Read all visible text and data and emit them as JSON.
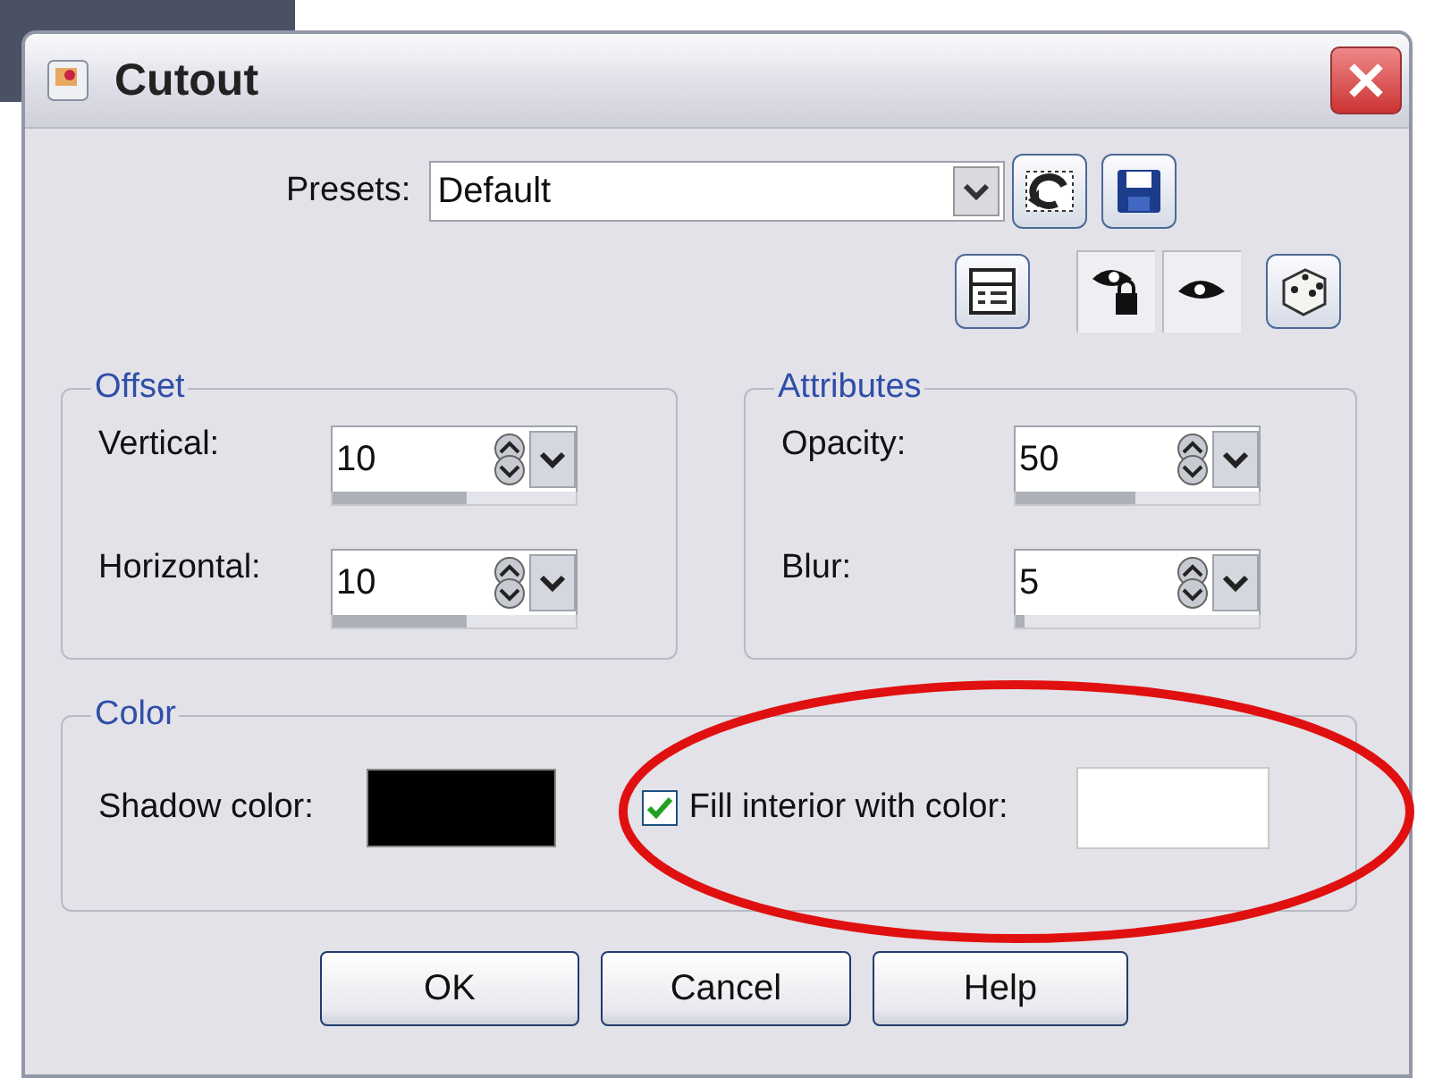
{
  "window": {
    "title": "Cutout"
  },
  "presets": {
    "label": "Presets:",
    "value": "Default"
  },
  "offset": {
    "title": "Offset",
    "fields": [
      {
        "label": "Vertical:",
        "value": "10",
        "level": 0.55
      },
      {
        "label": "Horizontal:",
        "value": "10",
        "level": 0.55
      }
    ]
  },
  "attributes": {
    "title": "Attributes",
    "fields": [
      {
        "label": "Opacity:",
        "value": "50",
        "level": 0.49
      },
      {
        "label": "Blur:",
        "value": "5",
        "level": 0.04
      }
    ]
  },
  "color": {
    "title": "Color",
    "shadow": {
      "label": "Shadow color:",
      "color": "#000000"
    },
    "fill": {
      "label": "Fill interior with color:",
      "checked": true,
      "color": "#ffffff"
    }
  },
  "buttons": [
    "OK",
    "Cancel",
    "Help"
  ]
}
